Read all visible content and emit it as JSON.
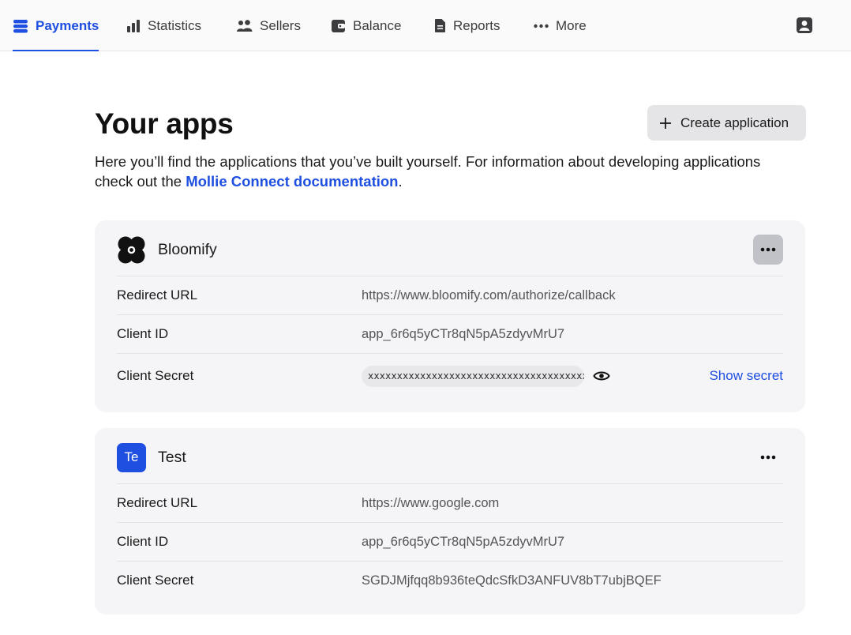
{
  "nav": {
    "items": [
      {
        "label": "Payments",
        "icon": "payments-icon",
        "active": true
      },
      {
        "label": "Statistics",
        "icon": "bar-chart-icon"
      },
      {
        "label": "Sellers",
        "icon": "users-icon"
      },
      {
        "label": "Balance",
        "icon": "wallet-icon"
      },
      {
        "label": "Reports",
        "icon": "document-icon"
      },
      {
        "label": "More",
        "icon": "more-dots-icon"
      }
    ],
    "account_icon": "user-account-icon"
  },
  "page": {
    "title": "Your apps",
    "create_button": "Create application",
    "intro_text": "Here you’ll find the applications that you’ve built yourself. For information about developing applications check out the ",
    "intro_link": "Mollie Connect documentation",
    "intro_end": "."
  },
  "apps": [
    {
      "name": "Bloomify",
      "logo": "bloomify-logo-icon",
      "redirect_label": "Redirect URL",
      "redirect_url": "https://www.bloomify.com/authorize/callback",
      "client_id_label": "Client ID",
      "client_id": "app_6r6q5yCTr8qN5pA5zdyvMrU7",
      "client_secret_label": "Client Secret",
      "client_secret_masked": "xxxxxxxxxxxxxxxxxxxxxxxxxxxxxxxxxxxxxx",
      "show_secret_label": "Show secret"
    },
    {
      "name": "Test",
      "badge": "Te",
      "redirect_label": "Redirect URL",
      "redirect_url": "https://www.google.com",
      "client_id_label": "Client ID",
      "client_id": "app_6r6q5yCTr8qN5pA5zdyvMrU7",
      "client_secret_label": "Client Secret",
      "client_secret": "SGDJMjfqq8b936teQdcSfkD3ANFUV8bT7ubjBQEF"
    }
  ],
  "colors": {
    "accent": "#1f4fe0",
    "card_bg": "#f5f5f7",
    "nav_bg": "#fafafa"
  }
}
